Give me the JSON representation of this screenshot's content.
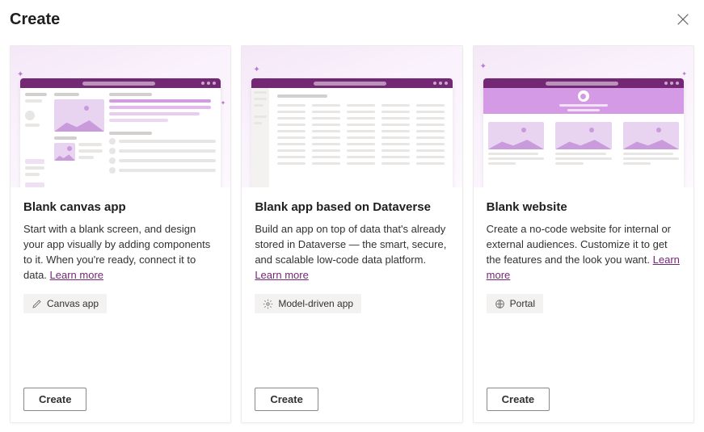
{
  "header": {
    "title": "Create"
  },
  "cards": [
    {
      "title": "Blank canvas app",
      "description": "Start with a blank screen, and design your app visually by adding components to it. When you're ready, connect it to data. ",
      "learn_more": "Learn more",
      "badge": {
        "icon": "pencil-icon",
        "label": "Canvas app"
      },
      "create_label": "Create"
    },
    {
      "title": "Blank app based on Dataverse",
      "description": "Build an app on top of data that's already stored in Dataverse — the smart, secure, and scalable low-code data platform. ",
      "learn_more": "Learn more",
      "badge": {
        "icon": "gear-icon",
        "label": "Model-driven app"
      },
      "create_label": "Create"
    },
    {
      "title": "Blank website",
      "description": "Create a no-code website for internal or external audiences. Customize it to get the features and the look you want. ",
      "learn_more": "Learn more",
      "badge": {
        "icon": "globe-icon",
        "label": "Portal"
      },
      "create_label": "Create"
    }
  ]
}
